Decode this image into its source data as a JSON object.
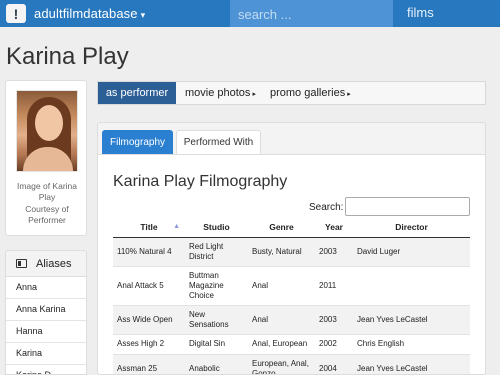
{
  "nav": {
    "logo_glyph": "!",
    "brand": "adultfilmdatabase",
    "brand_caret": "▾",
    "search_placeholder": "search ...",
    "films_label": "films"
  },
  "page": {
    "title": "Karina Play"
  },
  "portrait": {
    "caption_line1": "Image of Karina",
    "caption_line2": "Play",
    "caption_line3": "Courtesy of",
    "caption_line4": "Performer"
  },
  "aliases": {
    "heading": "Aliases",
    "items": [
      "Anna",
      "Anna Karina",
      "Hanna",
      "Karina",
      "Karina D"
    ]
  },
  "subnav": {
    "items": [
      "as performer",
      "movie photos",
      "promo galleries"
    ],
    "arrow": "▸"
  },
  "tabs": [
    "Filmography",
    "Performed With"
  ],
  "filmography": {
    "title": "Karina Play Filmography",
    "search_label": "Search:",
    "sort_glyph": "▲",
    "columns": [
      "Title",
      "Studio",
      "Genre",
      "Year",
      "Director"
    ],
    "rows": [
      {
        "title": "110% Natural 4",
        "studio": "Red Light District",
        "genre": "Busty, Natural",
        "year": "2003",
        "director": "David Luger"
      },
      {
        "title": "Anal Attack 5",
        "studio": "Buttman Magazine Choice",
        "genre": "Anal",
        "year": "2011",
        "director": ""
      },
      {
        "title": "Ass Wide Open",
        "studio": "New Sensations",
        "genre": "Anal",
        "year": "2003",
        "director": "Jean Yves LeCastel"
      },
      {
        "title": "Asses High 2",
        "studio": "Digital Sin",
        "genre": "Anal, European",
        "year": "2002",
        "director": "Chris English"
      },
      {
        "title": "Assman 25",
        "studio": "Anabolic",
        "genre": "European, Anal, Gonzo",
        "year": "2004",
        "director": "Jean Yves LeCastel"
      }
    ]
  }
}
